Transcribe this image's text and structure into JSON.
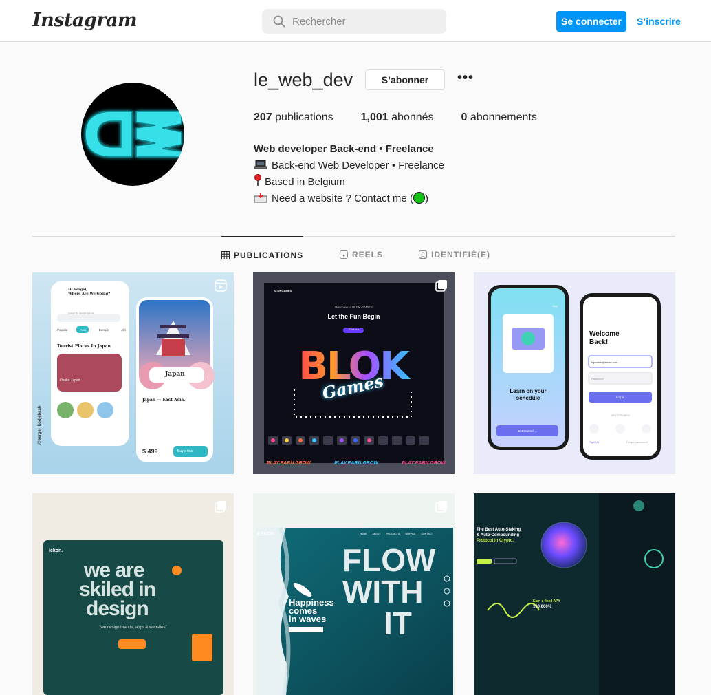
{
  "header": {
    "logo": "Instagram",
    "search_placeholder": "Rechercher",
    "login_label": "Se connecter",
    "signup_label": "S’inscrire"
  },
  "profile": {
    "username": "le_web_dev",
    "follow_label": "S’abonner",
    "more_label": "•••",
    "stats": {
      "posts_count": "207",
      "posts_label": "publications",
      "followers_count": "1,001",
      "followers_label": "abonnés",
      "following_count": "0",
      "following_label": "abonnements"
    },
    "bio": {
      "name": "Web developer Back-end • Freelance",
      "line1": "Back-end Web Developer • Freelance",
      "line2": "Based in Belgium",
      "line3_prefix": "Need a website ? Contact me (",
      "line3_suffix": ")"
    },
    "avatar_text": "DW"
  },
  "tabs": [
    {
      "label": "PUBLICATIONS",
      "icon": "grid-icon",
      "active": true
    },
    {
      "label": "REELS",
      "icon": "reels-icon",
      "active": false
    },
    {
      "label": "IDENTIFIÉ(E)",
      "icon": "tagged-icon",
      "active": false
    }
  ],
  "posts": {
    "p1": {
      "greeting": "Hi Sergei,",
      "question": "Where Are We Going?",
      "search": "Search destination",
      "chips": [
        "Popular",
        "Asia",
        "Europe",
        "Afri"
      ],
      "section": "Tourist Places In Japan",
      "card": "Osaka Japan",
      "title": "Japan",
      "subtitle": "Japan — East Asia.",
      "price": "$ 499",
      "cta": "Buy a tour",
      "handle": "@sergei_kodjebash"
    },
    "p2": {
      "nav_logo": "BLOKGAMES",
      "welcome": "Welcome to BLOK GAMES",
      "headline": "Let the Fun Begin",
      "cta": "Find out",
      "title": "BLOK",
      "script": "Games",
      "footer": "PLAY.EARN.GROW"
    },
    "p3": {
      "skip": "Skip",
      "headline": "Learn on your schedule",
      "cta": "Get Started →",
      "welcome": "Welcome Back!",
      "email": "kgordner@email.com",
      "password": "Password",
      "login": "Log in",
      "or": "OR LOGIN WITH",
      "signup": "Sign Up",
      "forgot": "Forgot password?"
    },
    "p4": {
      "brand": "ickon.",
      "headline1": "we are",
      "headline2": "skiled in",
      "headline3": "design",
      "tagline": "\"we design brands, apps & websites\""
    },
    "p5": {
      "brand": "ESKOR",
      "nav": [
        "HOME",
        "ABOUT",
        "PRODUCTS",
        "SERVICE",
        "CONTACT"
      ],
      "big1": "FLOW",
      "big2": "WITH",
      "big3": "IT",
      "headline1": "Happiness",
      "headline2": "comes",
      "headline3": "in waves"
    },
    "p6": {
      "headline1": "The Best Auto-Staking",
      "headline2": "& Auto-Compounding",
      "headline3": "Protocol in Crypto.",
      "apy_label": "Earn a fixed APY",
      "apy_value": "100,000%"
    }
  },
  "colors": {
    "accent": "#0095f6",
    "border": "#dbdbdb",
    "muted": "#8e8e8e",
    "avatar_glow": "#35e0e8"
  }
}
